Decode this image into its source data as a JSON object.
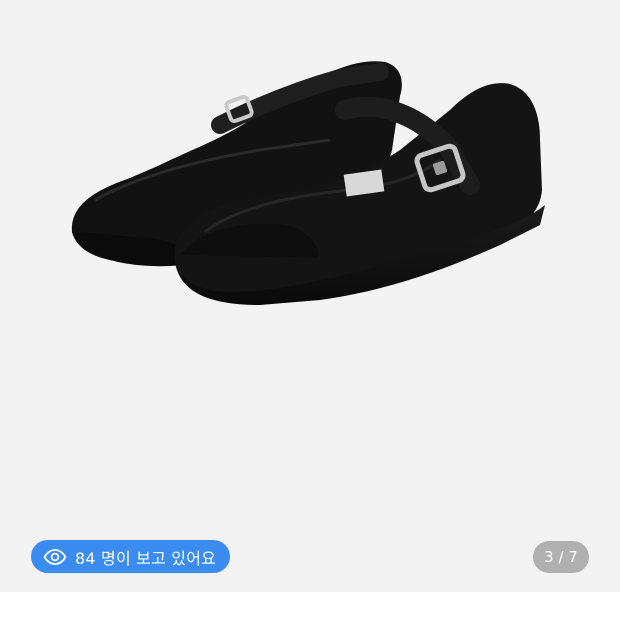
{
  "gallery": {
    "image_name": "black-mary-jane-shoes",
    "viewers_text": "84 명이 보고 있어요",
    "page_counter": "3 / 7",
    "badge_color": "#3b8cf0",
    "eye_icon": "eye-icon"
  }
}
